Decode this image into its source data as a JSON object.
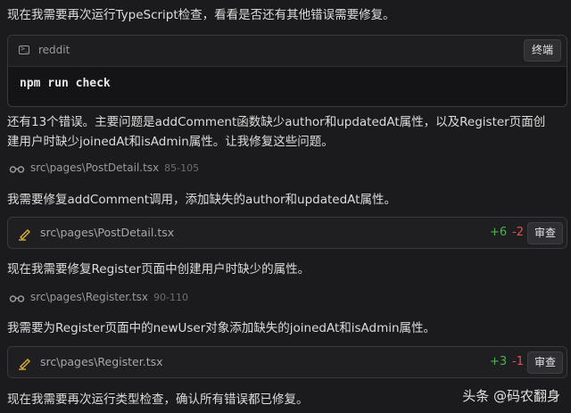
{
  "messages": {
    "m1": "现在我需要再次运行TypeScript检查，看看是否还有其他错误需要修复。",
    "m2a": "还有13个错误。主要问题是addComment函数缺少author和updatedAt属性，以及Register页面创",
    "m2b": "建用户时缺少joinedAt和isAdmin属性。让我修复这些问题。",
    "m3": "我需要修复addComment调用，添加缺失的author和updatedAt属性。",
    "m4": "现在我需要修复Register页面中创建用户时缺少的属性。",
    "m5": "我需要为Register页面中的newUser对象添加缺失的joinedAt和isAdmin属性。",
    "m6": "现在我需要再次运行类型检查，确认所有错误都已修复。"
  },
  "command_card": {
    "label": "reddit",
    "button": "终端",
    "command": "npm run check"
  },
  "read1": {
    "path": "src\\pages\\PostDetail.tsx",
    "range": "85-105"
  },
  "read2": {
    "path": "src\\pages\\Register.tsx",
    "range": "90-110"
  },
  "edit1": {
    "path": "src\\pages\\PostDetail.tsx",
    "added": "+6",
    "removed": "-2",
    "button": "审查"
  },
  "edit2": {
    "path": "src\\pages\\Register.tsx",
    "added": "+3",
    "removed": "-1",
    "button": "审查"
  },
  "watermark": "头条 @码农翻身",
  "colors": {
    "added": "#4caf50",
    "removed": "#e05252",
    "background": "#1b1b1d"
  },
  "icons": {
    "terminal": "terminal-icon",
    "read": "glasses-icon",
    "edit": "pencil-icon"
  }
}
